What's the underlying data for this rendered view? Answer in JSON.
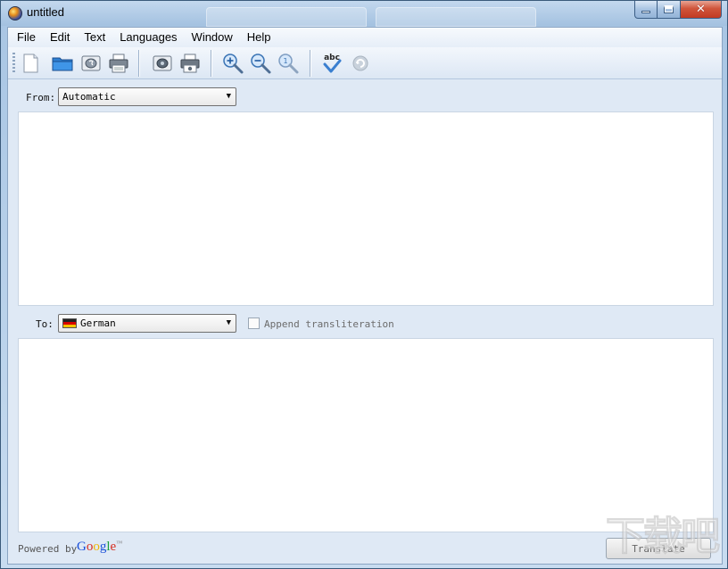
{
  "window": {
    "title": "untitled"
  },
  "menu": [
    "File",
    "Edit",
    "Text",
    "Languages",
    "Window",
    "Help"
  ],
  "toolbar": {
    "buttons": [
      "new-document-icon",
      "open-folder-icon",
      "speak-icon",
      "print-icon",
      "speak-translation-icon",
      "print-translation-icon",
      "zoom-in-icon",
      "zoom-out-icon",
      "zoom-reset-icon",
      "spellcheck-icon",
      "refresh-icon"
    ],
    "spellcheck_text": "abc"
  },
  "source": {
    "label": "From:",
    "language": "Automatic",
    "text": ""
  },
  "target": {
    "label": "To:",
    "language": "German",
    "append_transliteration": {
      "label": "Append transliteration",
      "checked": false
    },
    "text": ""
  },
  "footer": {
    "powered_by": "Powered by",
    "google": "Google",
    "google_tm": "™",
    "translate_label": "Translate"
  },
  "colors": {
    "accent": "#3a6ea5",
    "client_bg": "#dfe9f5"
  },
  "watermark": "下载吧"
}
